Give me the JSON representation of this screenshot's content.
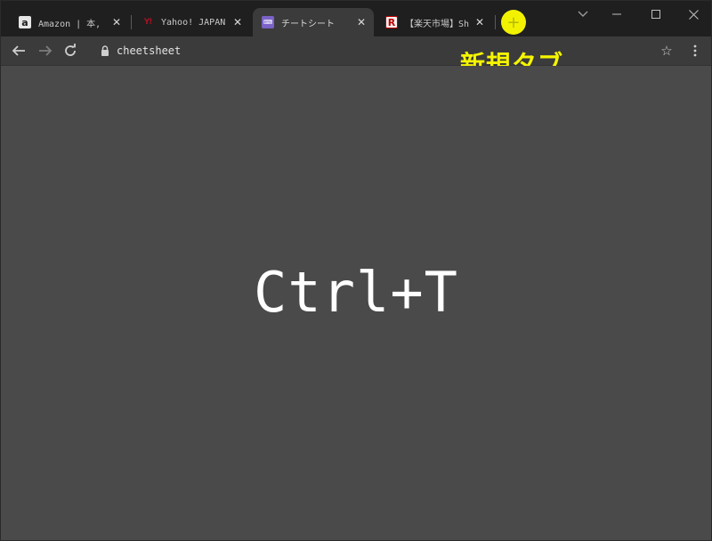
{
  "tabs": [
    {
      "title": "Amazon | 本, ",
      "favicon": "amazon-favicon",
      "favicon_glyph": "a",
      "active": false
    },
    {
      "title": "Yahoo! JAPAN",
      "favicon": "yahoo-favicon",
      "favicon_glyph": "Y!",
      "active": false
    },
    {
      "title": "チートシート",
      "favicon": "cheatsheet-favicon",
      "favicon_glyph": "⌨",
      "active": true
    },
    {
      "title": "【楽天市場】Sh",
      "favicon": "rakuten-favicon",
      "favicon_glyph": "R",
      "active": false
    }
  ],
  "new_tab": {
    "icon": "plus-icon",
    "glyph": "+",
    "highlight_color": "#f2f200"
  },
  "window_controls": {
    "tab_search_icon": "chevron-down-icon",
    "minimize_icon": "minimize-icon",
    "maximize_icon": "maximize-icon",
    "close_icon": "close-icon"
  },
  "toolbar": {
    "back_icon": "back-arrow-icon",
    "forward_icon": "forward-arrow-icon",
    "reload_icon": "reload-icon",
    "url": "cheetsheet",
    "lock_icon": "lock-icon",
    "bookmark_icon": "star-icon",
    "menu_icon": "kebab-menu-icon"
  },
  "annotation": {
    "label": "新規タブ",
    "color": "#f5f500"
  },
  "content": {
    "shortcut": "Ctrl+T"
  }
}
